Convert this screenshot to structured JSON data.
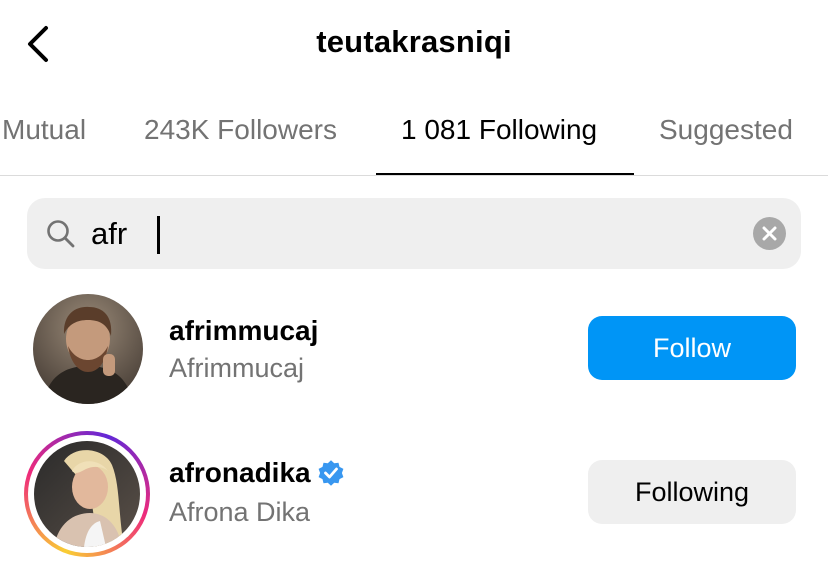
{
  "header": {
    "title": "teutakrasniqi",
    "back_icon": "chevron-left-icon"
  },
  "tabs": [
    {
      "label": "Mutual",
      "active": false
    },
    {
      "label": "243K Followers",
      "active": false
    },
    {
      "label": "1 081 Following",
      "active": true
    },
    {
      "label": "Suggested",
      "active": false
    }
  ],
  "search": {
    "icon": "search-icon",
    "value": "afr",
    "clear_icon": "clear-icon"
  },
  "results": [
    {
      "username": "afrimmucaj",
      "full_name": "Afrimmucaj",
      "verified": false,
      "has_story": false,
      "button_label": "Follow",
      "button_color": "#0095f6"
    },
    {
      "username": "afronadika",
      "full_name": "Afrona Dika",
      "verified": true,
      "has_story": true,
      "button_label": "Following",
      "button_color": "#efefef"
    }
  ],
  "colors": {
    "accent": "#0095f6",
    "verified": "#3897f0",
    "secondary_text": "#737373"
  }
}
